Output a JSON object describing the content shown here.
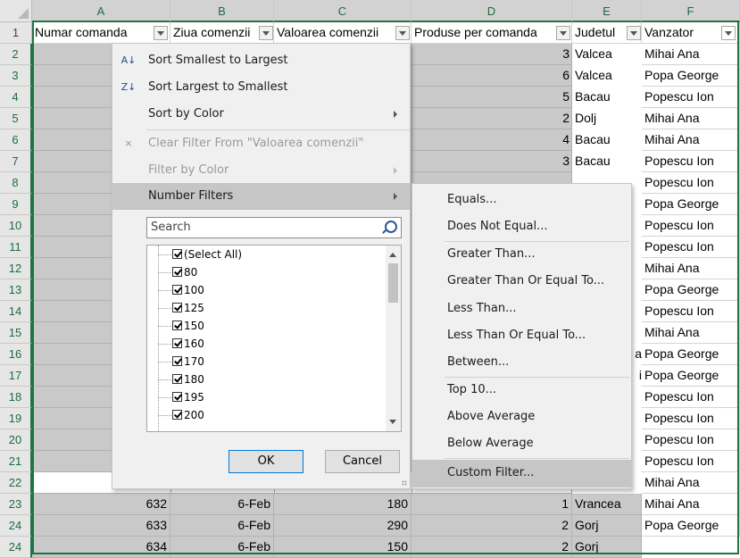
{
  "sheet": {
    "columns": [
      "A",
      "B",
      "C",
      "D",
      "E",
      "F"
    ],
    "rows": [
      "1",
      "2",
      "3",
      "4",
      "5",
      "6",
      "7",
      "8",
      "9",
      "10",
      "11",
      "12",
      "13",
      "14",
      "15",
      "16",
      "17",
      "18",
      "19",
      "20",
      "21",
      "22",
      "23",
      "24"
    ],
    "headers": [
      "Numar comanda",
      "Ziua comenzii",
      "Valoarea comenzii",
      "Produse per comanda",
      "Judetul",
      "Vanzator"
    ],
    "d_values": [
      "3",
      "6",
      "5",
      "2",
      "4",
      "3"
    ],
    "e_values": [
      "Valcea",
      "Valcea",
      "Bacau",
      "Dolj",
      "Bacau",
      "Bacau"
    ],
    "e_partial": {
      "r15": "a",
      "r16": "i"
    },
    "f_values": [
      "Mihai Ana",
      "Popa George",
      "Popescu Ion",
      "Mihai Ana",
      "Mihai Ana",
      "Popescu Ion",
      "Popescu Ion",
      "Popa George",
      "Popescu Ion",
      "Popescu Ion",
      "Mihai Ana",
      "Popa George",
      "Popescu Ion",
      "Mihai Ana",
      "Popa George",
      "Popa George",
      "Popescu Ion",
      "Popescu Ion",
      "Popescu Ion",
      "Popescu Ion",
      "Mihai Ana",
      "Mihai Ana",
      "Popa George"
    ],
    "bottom_rows": [
      {
        "a": "632",
        "b": "6-Feb",
        "c": "180",
        "d": "1",
        "e": "Vrancea"
      },
      {
        "a": "633",
        "b": "6-Feb",
        "c": "290",
        "d": "2",
        "e": "Gorj"
      },
      {
        "a": "634",
        "b": "6-Feb",
        "c": "150",
        "d": "2",
        "e": "Gorj"
      }
    ]
  },
  "filter_menu": {
    "sort_asc": "Sort Smallest to Largest",
    "sort_desc": "Sort Largest to Smallest",
    "sort_color": "Sort by Color",
    "clear_filter": "Clear Filter From \"Valoarea comenzii\"",
    "filter_color": "Filter by Color",
    "number_filters": "Number Filters",
    "search_placeholder": "Search",
    "list_items": [
      "(Select All)",
      "80",
      "100",
      "125",
      "150",
      "160",
      "170",
      "180",
      "195",
      "200"
    ],
    "ok": "OK",
    "cancel": "Cancel"
  },
  "number_filters_submenu": [
    "Equals...",
    "Does Not Equal...",
    "Greater Than...",
    "Greater Than Or Equal To...",
    "Less Than...",
    "Less Than Or Equal To...",
    "Between...",
    "Top 10...",
    "Above Average",
    "Below Average",
    "Custom Filter..."
  ],
  "colors": {
    "accent": "#217346",
    "selected_fill": "#c9c9c9",
    "menu_bg": "#f0f0f0",
    "highlight": "#c6c6c6"
  }
}
